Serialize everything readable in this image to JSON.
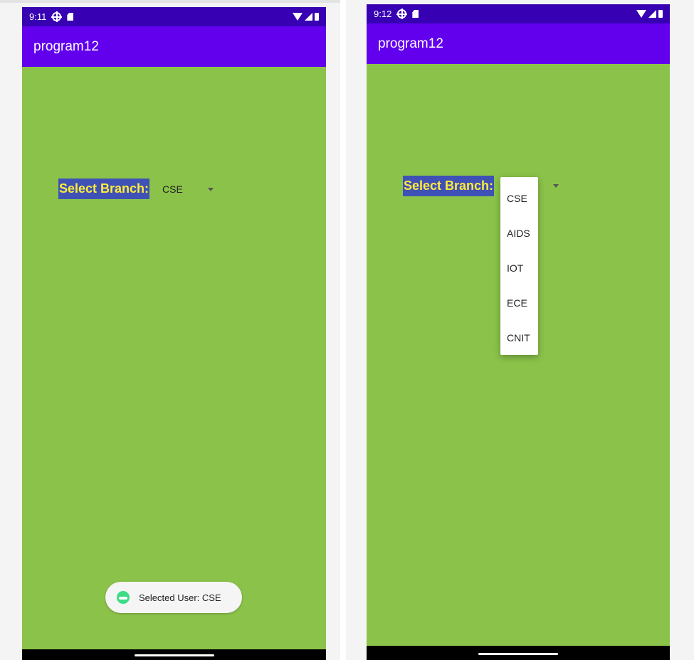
{
  "colors": {
    "status_bar": "#3700b3",
    "app_bar": "#6200ee",
    "background": "#8bc34a",
    "label_background": "#3f51b5",
    "label_text": "#ffeb3b",
    "toast_icon": "#3ddc84"
  },
  "left_screen": {
    "status_bar": {
      "time": "9:11",
      "icons": [
        "target-icon",
        "sd-card-icon",
        "wifi-icon",
        "signal-icon",
        "battery-icon"
      ]
    },
    "app_bar": {
      "title": "program12"
    },
    "branch_label": "Select Branch:",
    "spinner": {
      "selected": "CSE",
      "icon": "dropdown-arrow-icon"
    },
    "toast": {
      "text": "Selected User: CSE",
      "icon": "android-icon"
    }
  },
  "right_screen": {
    "status_bar": {
      "time": "9:12",
      "icons": [
        "target-icon",
        "sd-card-icon",
        "wifi-icon",
        "signal-icon",
        "battery-icon"
      ]
    },
    "app_bar": {
      "title": "program12"
    },
    "branch_label": "Select Branch:",
    "spinner": {
      "icon": "dropdown-arrow-icon"
    },
    "dropdown": {
      "options": [
        "CSE",
        "AIDS",
        "IOT",
        "ECE",
        "CNIT"
      ]
    }
  }
}
